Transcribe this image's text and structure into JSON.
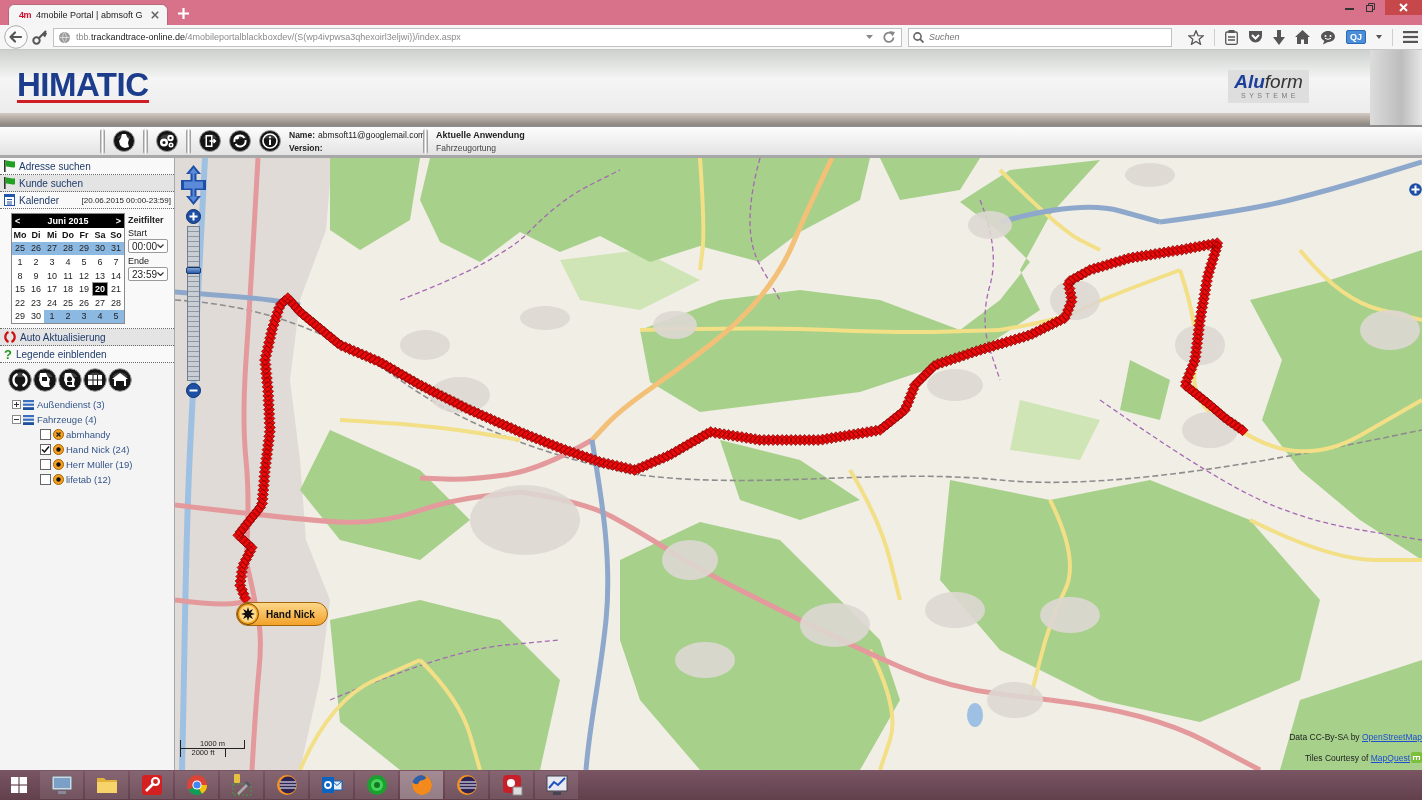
{
  "browser": {
    "tabs": [
      {
        "favicon": "4m",
        "title": "4mobile Portal | abmsoft G",
        "selected": true
      }
    ],
    "address": {
      "prefix": "tbb.",
      "domain": "trackandtrace-online.de",
      "path": "/4mobileportalblackboxdev/(S(wp4ivpwsa3qhexoirl3eljwi))/index.aspx"
    },
    "search": {
      "placeholder": "Suchen"
    },
    "profile_badge": "QJ"
  },
  "header": {
    "logo": "HIMATIC",
    "partner_logo": "**Alu**form",
    "partner_tagline": "SYSTEME"
  },
  "toolbar": {
    "name_label": "Name:",
    "name_value": "abmsoft11@googlemail.com",
    "version_label": "Version:",
    "app_label": "Aktuelle Anwendung",
    "app_value": "Fahrzeugortung"
  },
  "sidebar": {
    "sections": [
      {
        "kind": "flag",
        "label": "Adresse suchen"
      },
      {
        "kind": "flag",
        "label": "Kunde suchen"
      },
      {
        "kind": "calendar",
        "label": "Kalender",
        "range": "[20.06.2015 00:00-23:59]"
      },
      {
        "kind": "refresh",
        "label": "Auto Aktualisierung"
      },
      {
        "kind": "help",
        "glyph": "?",
        "label": "Legende einblenden"
      }
    ],
    "calendar": {
      "prev": "<",
      "month": "Juni 2015",
      "next": ">",
      "weekdays": [
        "Mo",
        "Di",
        "Mi",
        "Do",
        "Fr",
        "Sa",
        "So"
      ],
      "weeks": [
        [
          {
            "day": "25",
            "other_month": true,
            "selected": false
          },
          {
            "day": "26",
            "other_month": true,
            "selected": false
          },
          {
            "day": "27",
            "other_month": true,
            "selected": false
          },
          {
            "day": "28",
            "other_month": true,
            "selected": false
          },
          {
            "day": "29",
            "other_month": true,
            "selected": false
          },
          {
            "day": "30",
            "other_month": true,
            "selected": false
          },
          {
            "day": "31",
            "other_month": true,
            "selected": false
          }
        ],
        [
          {
            "day": "1",
            "other_month": false,
            "selected": false
          },
          {
            "day": "2",
            "other_month": false,
            "selected": false
          },
          {
            "day": "3",
            "other_month": false,
            "selected": false
          },
          {
            "day": "4",
            "other_month": false,
            "selected": false
          },
          {
            "day": "5",
            "other_month": false,
            "selected": false
          },
          {
            "day": "6",
            "other_month": false,
            "selected": false
          },
          {
            "day": "7",
            "other_month": false,
            "selected": false
          }
        ],
        [
          {
            "day": "8",
            "other_month": false,
            "selected": false
          },
          {
            "day": "9",
            "other_month": false,
            "selected": false
          },
          {
            "day": "10",
            "other_month": false,
            "selected": false
          },
          {
            "day": "11",
            "other_month": false,
            "selected": false
          },
          {
            "day": "12",
            "other_month": false,
            "selected": false
          },
          {
            "day": "13",
            "other_month": false,
            "selected": false
          },
          {
            "day": "14",
            "other_month": false,
            "selected": false
          }
        ],
        [
          {
            "day": "15",
            "other_month": false,
            "selected": false
          },
          {
            "day": "16",
            "other_month": false,
            "selected": false
          },
          {
            "day": "17",
            "other_month": false,
            "selected": false
          },
          {
            "day": "18",
            "other_month": false,
            "selected": false
          },
          {
            "day": "19",
            "other_month": false,
            "selected": false
          },
          {
            "day": "20",
            "other_month": false,
            "selected": true
          },
          {
            "day": "21",
            "other_month": false,
            "selected": false
          }
        ],
        [
          {
            "day": "22",
            "other_month": false,
            "selected": false
          },
          {
            "day": "23",
            "other_month": false,
            "selected": false
          },
          {
            "day": "24",
            "other_month": false,
            "selected": false
          },
          {
            "day": "25",
            "other_month": false,
            "selected": false
          },
          {
            "day": "26",
            "other_month": false,
            "selected": false
          },
          {
            "day": "27",
            "other_month": false,
            "selected": false
          },
          {
            "day": "28",
            "other_month": false,
            "selected": false
          }
        ],
        [
          {
            "day": "29",
            "other_month": false,
            "selected": false
          },
          {
            "day": "30",
            "other_month": false,
            "selected": false
          },
          {
            "day": "1",
            "other_month": true,
            "selected": false
          },
          {
            "day": "2",
            "other_month": true,
            "selected": false
          },
          {
            "day": "3",
            "other_month": true,
            "selected": false
          },
          {
            "day": "4",
            "other_month": true,
            "selected": false
          },
          {
            "day": "5",
            "other_month": true,
            "selected": false
          }
        ]
      ]
    },
    "time_filter": {
      "title": "Zeitfilter",
      "start_label": "Start",
      "start_value": "00:00",
      "end_label": "Ende",
      "end_value": "23:59"
    },
    "tree": [
      {
        "label": "Außendienst (3)",
        "expanded": false
      },
      {
        "label": "Fahrzeuge (4)",
        "expanded": true,
        "children": [
          {
            "label": "abmhandy",
            "kind": "cross",
            "checked": false
          },
          {
            "label": "Hand Nick (24)",
            "kind": "dot",
            "checked": true
          },
          {
            "label": "Herr Müller (19)",
            "kind": "dot",
            "checked": false
          },
          {
            "label": "lifetab (12)",
            "kind": "dot",
            "checked": false
          }
        ]
      }
    ]
  },
  "map": {
    "zoom_slider": {
      "level": 0.73
    },
    "marker": {
      "label": "Hand Nick"
    },
    "scale": {
      "metric": "1000 m",
      "imperial": "2000 ft"
    },
    "attribution": [
      {
        "text": "Data CC-By-SA by",
        "link": "OpenStreetMap"
      },
      {
        "text": "Tiles Courtesy of",
        "link": "MapQuest"
      }
    ]
  },
  "taskbar": {
    "apps": [
      {
        "kind": "monitor",
        "selected": false
      },
      {
        "kind": "folder",
        "selected": false
      },
      {
        "kind": "wrench",
        "selected": false
      },
      {
        "kind": "wheel",
        "selected": false
      },
      {
        "kind": "tools",
        "selected": false
      },
      {
        "kind": "stripes",
        "selected": false
      },
      {
        "kind": "mail",
        "selected": false
      },
      {
        "kind": "orb",
        "selected": false
      },
      {
        "kind": "globe",
        "selected": true
      },
      {
        "kind": "stripes",
        "selected": false
      },
      {
        "kind": "pin",
        "selected": false
      },
      {
        "kind": "chart",
        "selected": false
      }
    ]
  }
}
